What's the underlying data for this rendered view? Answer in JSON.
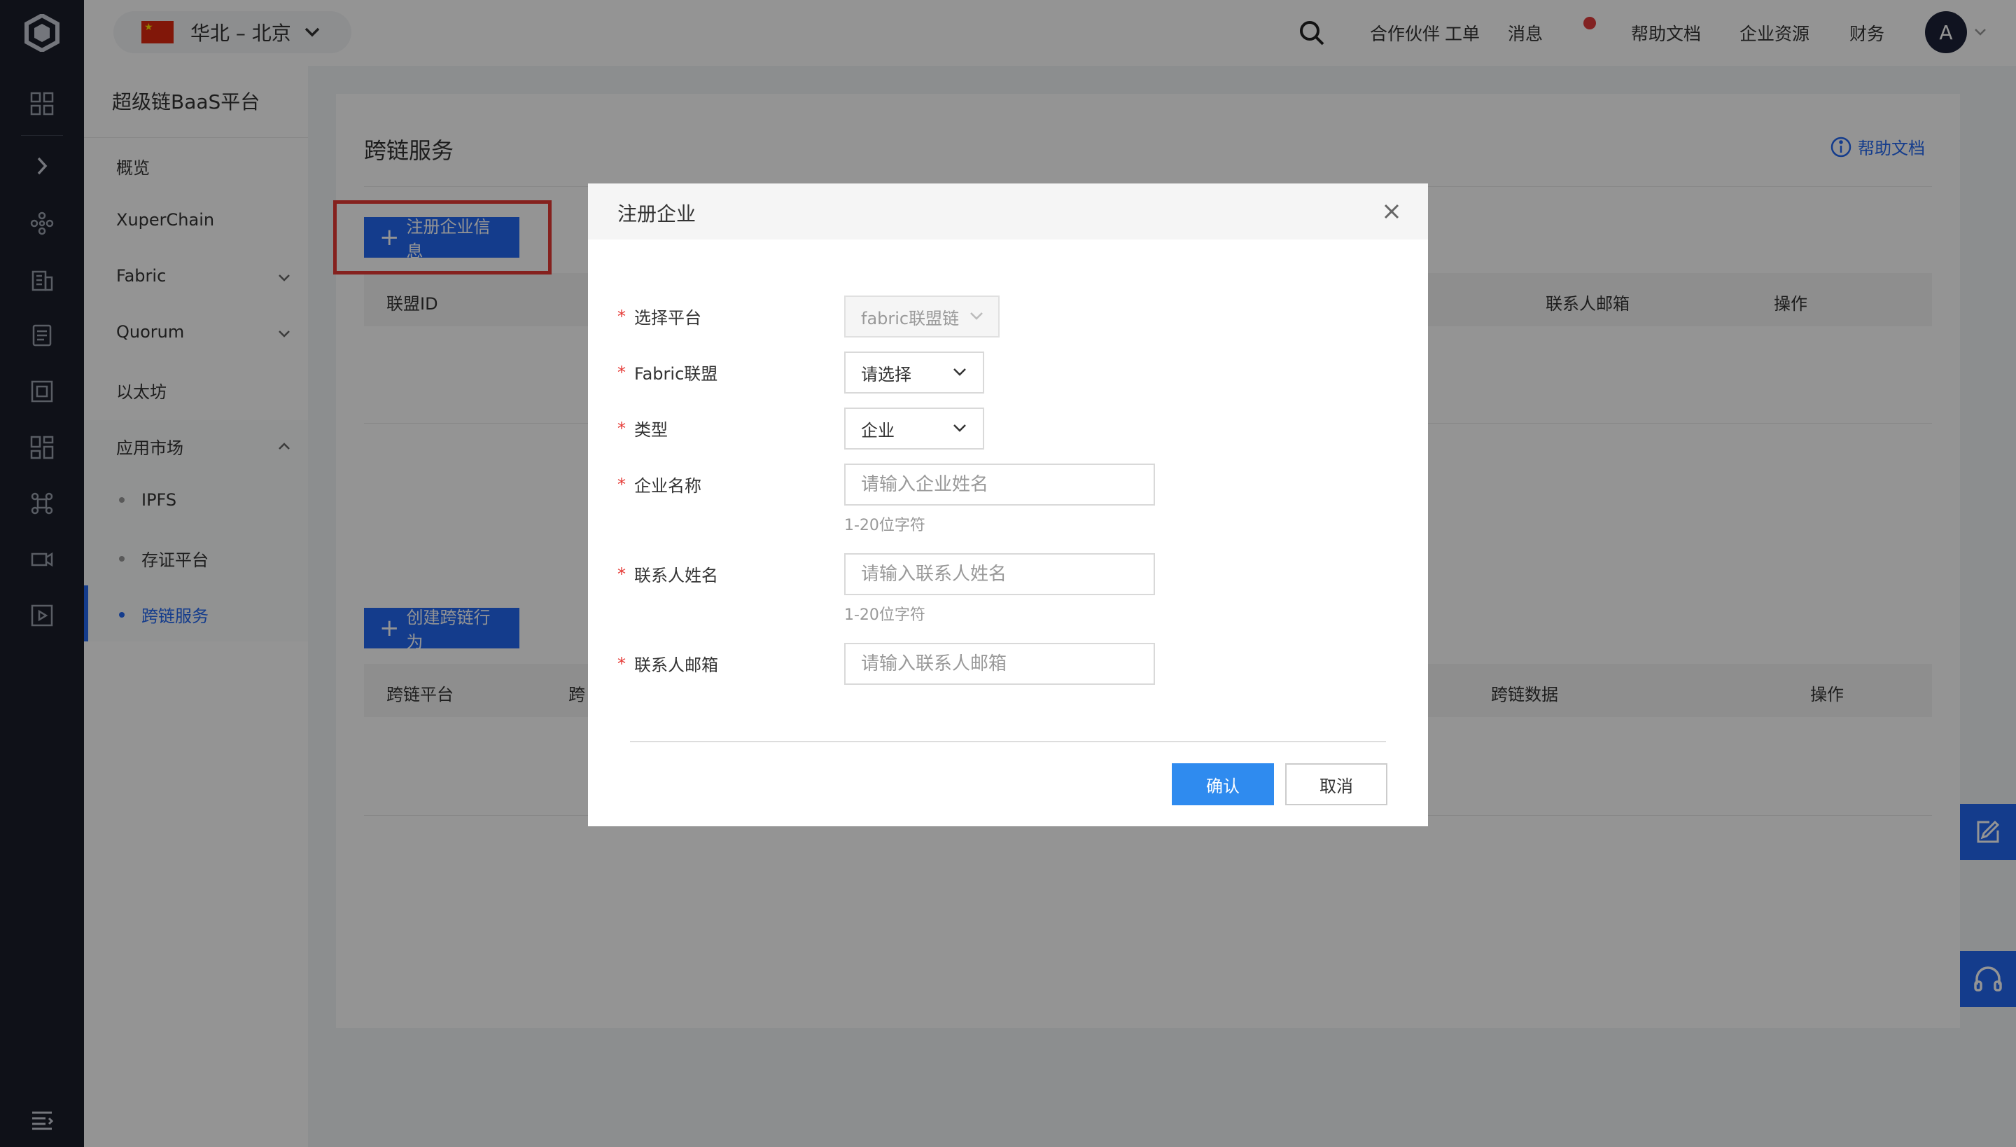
{
  "topbar": {
    "region": "华北 – 北京",
    "nav": [
      "合作伙伴",
      "工单",
      "消息",
      "帮助文档",
      "企业资源",
      "财务"
    ],
    "avatar": "A"
  },
  "sidebar": {
    "title": "超级链BaaS平台",
    "items": [
      "概览",
      "XuperChain",
      "Fabric",
      "Quorum",
      "以太坊",
      "应用市场"
    ],
    "sub_items": [
      "IPFS",
      "存证平台",
      "跨链服务"
    ]
  },
  "main": {
    "title": "跨链服务",
    "help_link": "帮助文档",
    "register_button": "注册企业信息",
    "table1_headers": [
      "联盟ID",
      "联系人邮箱",
      "操作"
    ],
    "create_button": "创建跨链行为",
    "table2_headers": [
      "跨链平台",
      "跨",
      "跨链数据",
      "操作"
    ]
  },
  "dialog": {
    "title": "注册企业",
    "fields": {
      "platform": {
        "label": "选择平台",
        "value": "fabric联盟链"
      },
      "consortium": {
        "label": "Fabric联盟",
        "value": "请选择"
      },
      "type": {
        "label": "类型",
        "value": "企业"
      },
      "company_name": {
        "label": "企业名称",
        "placeholder": "请输入企业姓名",
        "hint": "1-20位字符"
      },
      "contact_name": {
        "label": "联系人姓名",
        "placeholder": "请输入联系人姓名",
        "hint": "1-20位字符"
      },
      "contact_email": {
        "label": "联系人邮箱",
        "placeholder": "请输入联系人邮箱"
      }
    },
    "confirm": "确认",
    "cancel": "取消"
  },
  "colors": {
    "primary": "#2468f2",
    "confirm": "#2f8bef",
    "required": "#e53935",
    "highlight_border": "#e53935",
    "rail": "#1a1e2a"
  }
}
